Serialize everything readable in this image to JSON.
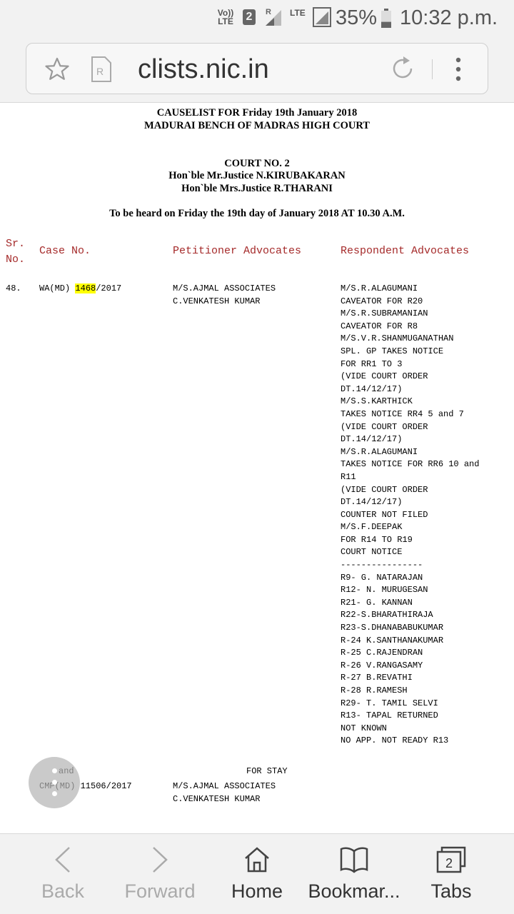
{
  "status": {
    "volte": "Vo)) LTE",
    "sim": "2",
    "net_r": "R",
    "lte": "LTE",
    "battery_pct": "35%",
    "battery_level": 0.35,
    "time": "10:32 p.m."
  },
  "browser": {
    "url": "clists.nic.in",
    "reader_icon_label": "R"
  },
  "doc": {
    "title1": "CAUSELIST FOR Friday 19th January 2018",
    "title2": "MADURAI BENCH OF MADRAS HIGH COURT",
    "court": "COURT NO. 2",
    "judge1": "Hon`ble Mr.Justice N.KIRUBAKARAN",
    "judge2": "Hon`ble Mrs.Justice R.THARANI",
    "heard": "To be heard on Friday the 19th day of January 2018 AT 10.30 A.M.",
    "col_sr": "Sr.",
    "col_no": "No.",
    "col_case": "Case No.",
    "col_pet": "Petitioner Advocates",
    "col_resp": "Respondent Advocates",
    "sr": "48.",
    "case_prefix": "WA(MD) ",
    "case_num": "1468",
    "case_suffix": "/2017",
    "petitioner": "M/S.AJMAL ASSOCIATES\nC.VENKATESH KUMAR",
    "respondent": "M/S.R.ALAGUMANI\nCAVEATOR FOR R20\nM/S.R.SUBRAMANIAN\nCAVEATOR FOR R8\nM/S.V.R.SHANMUGANATHAN\nSPL. GP TAKES NOTICE\nFOR RR1 TO 3\n(VIDE COURT ORDER\nDT.14/12/17)\nM/S.S.KARTHICK\nTAKES NOTICE RR4 5 and 7\n(VIDE COURT ORDER\nDT.14/12/17)\nM/S.R.ALAGUMANI\nTAKES NOTICE FOR RR6 10 and\nR11\n(VIDE COURT ORDER\nDT.14/12/17)\nCOUNTER NOT FILED\nM/S.F.DEEPAK\nFOR R14 TO R19\nCOURT NOTICE\n----------------\nR9- G. NATARAJAN\nR12- N. MURUGESAN\nR21- G. KANNAN\nR22-S.BHARATHIRAJA\nR23-S.DHANABABUKUMAR\nR-24 K.SANTHANAKUMAR\nR-25 C.RAJENDRAN\nR-26 V.RANGASAMY\nR-27 B.REVATHI\nR-28 R.RAMESH\nR29- T. TAMIL SELVI\nR13- TAPAL RETURNED\nNOT KNOWN\nNO APP. NOT READY R13",
    "and_label": "and",
    "for_stay": "FOR STAY",
    "cmp": "CMP(MD) 11506/2017",
    "cmp_petitioner": "M/S.AJMAL ASSOCIATES\nC.VENKATESH KUMAR"
  },
  "nav": {
    "back": "Back",
    "forward": "Forward",
    "home": "Home",
    "bookmarks": "Bookmar...",
    "tabs": "Tabs",
    "tabs_count": "2"
  }
}
